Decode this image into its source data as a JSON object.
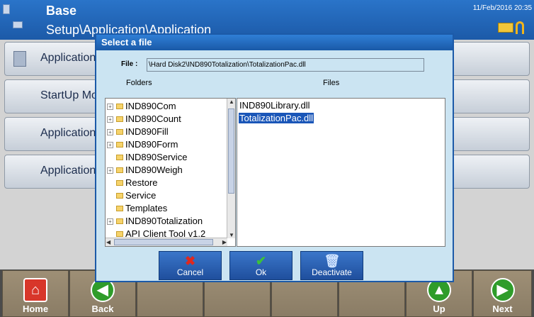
{
  "header": {
    "title": "Base",
    "path": "Setup\\Application\\Application",
    "datetime": "11/Feb/2016 20:35"
  },
  "menu": [
    {
      "label": "Application"
    },
    {
      "label": "StartUp Mo"
    },
    {
      "label": "Application"
    },
    {
      "label": "Application"
    }
  ],
  "footer": {
    "home_label": "Home",
    "back_label": "Back",
    "up_label": "Up",
    "next_label": "Next"
  },
  "dialog": {
    "title": "Select a file",
    "file_label": "File :",
    "file_value": "\\Hard Disk2\\IND890Totalization\\TotalizationPac.dll",
    "folders_header": "Folders",
    "files_header": "Files",
    "folders": [
      {
        "name": "IND890Com",
        "expandable": true
      },
      {
        "name": "IND890Count",
        "expandable": true
      },
      {
        "name": "IND890Fill",
        "expandable": true
      },
      {
        "name": "IND890Form",
        "expandable": true
      },
      {
        "name": "IND890Service",
        "expandable": false
      },
      {
        "name": "IND890Weigh",
        "expandable": true
      },
      {
        "name": "Restore",
        "expandable": false
      },
      {
        "name": "Service",
        "expandable": false
      },
      {
        "name": "Templates",
        "expandable": false
      },
      {
        "name": "IND890Totalization",
        "expandable": true
      },
      {
        "name": "API Client Tool v1.2",
        "expandable": false
      }
    ],
    "files": [
      {
        "name": "IND890Library.dll",
        "selected": false
      },
      {
        "name": "TotalizationPac.dll",
        "selected": true
      }
    ],
    "buttons": {
      "cancel": "Cancel",
      "ok": "Ok",
      "deactivate": "Deactivate"
    }
  },
  "icons": {
    "home": "home-icon",
    "back": "arrow-left-icon",
    "up": "arrow-up-icon",
    "next": "arrow-right-icon",
    "cancel": "x-icon",
    "ok": "checkmark-icon",
    "deactivate": "trash-icon"
  },
  "colors": {
    "header": "#1c5aa8",
    "dialog_bg": "#cbe4f2",
    "selection": "#1a56b8",
    "softkey": "#9e8f76"
  }
}
